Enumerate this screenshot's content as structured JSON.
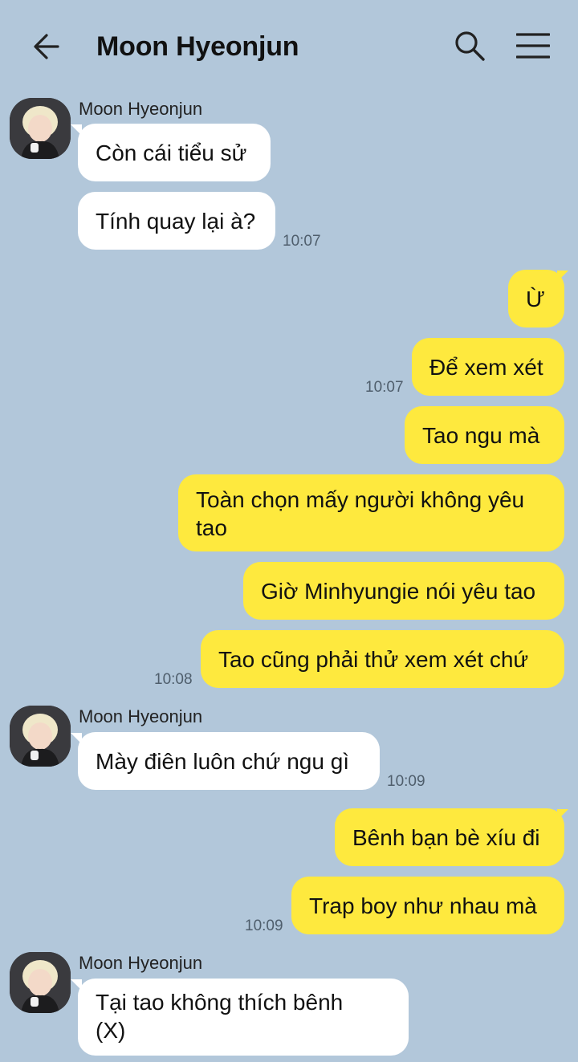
{
  "header": {
    "title": "Moon Hyeonjun",
    "back_icon": "arrow-left-icon",
    "search_icon": "search-icon",
    "menu_icon": "hamburger-menu-icon"
  },
  "colors": {
    "background": "#b2c7da",
    "incoming_bubble": "#ffffff",
    "outgoing_bubble": "#fee93e"
  },
  "messages": [
    {
      "sender": "Moon Hyeonjun",
      "text": "Còn cái tiểu sử"
    },
    {
      "text": "Tính quay lại à?",
      "time": "10:07"
    },
    {
      "text": "Ừ"
    },
    {
      "text": "Để xem xét",
      "time": "10:07"
    },
    {
      "text": "Tao ngu mà"
    },
    {
      "text": "Toàn chọn mấy người không yêu tao"
    },
    {
      "text": "Giờ Minhyungie nói yêu tao"
    },
    {
      "text": "Tao cũng phải thử xem xét chứ",
      "time": "10:08"
    },
    {
      "sender": "Moon Hyeonjun",
      "text": "Mày điên luôn chứ ngu gì",
      "time": "10:09"
    },
    {
      "text": "Bênh bạn bè xíu đi"
    },
    {
      "text": "Trap boy như nhau mà",
      "time": "10:09"
    },
    {
      "sender": "Moon Hyeonjun",
      "text": "Tại tao không thích bênh (X)"
    }
  ]
}
